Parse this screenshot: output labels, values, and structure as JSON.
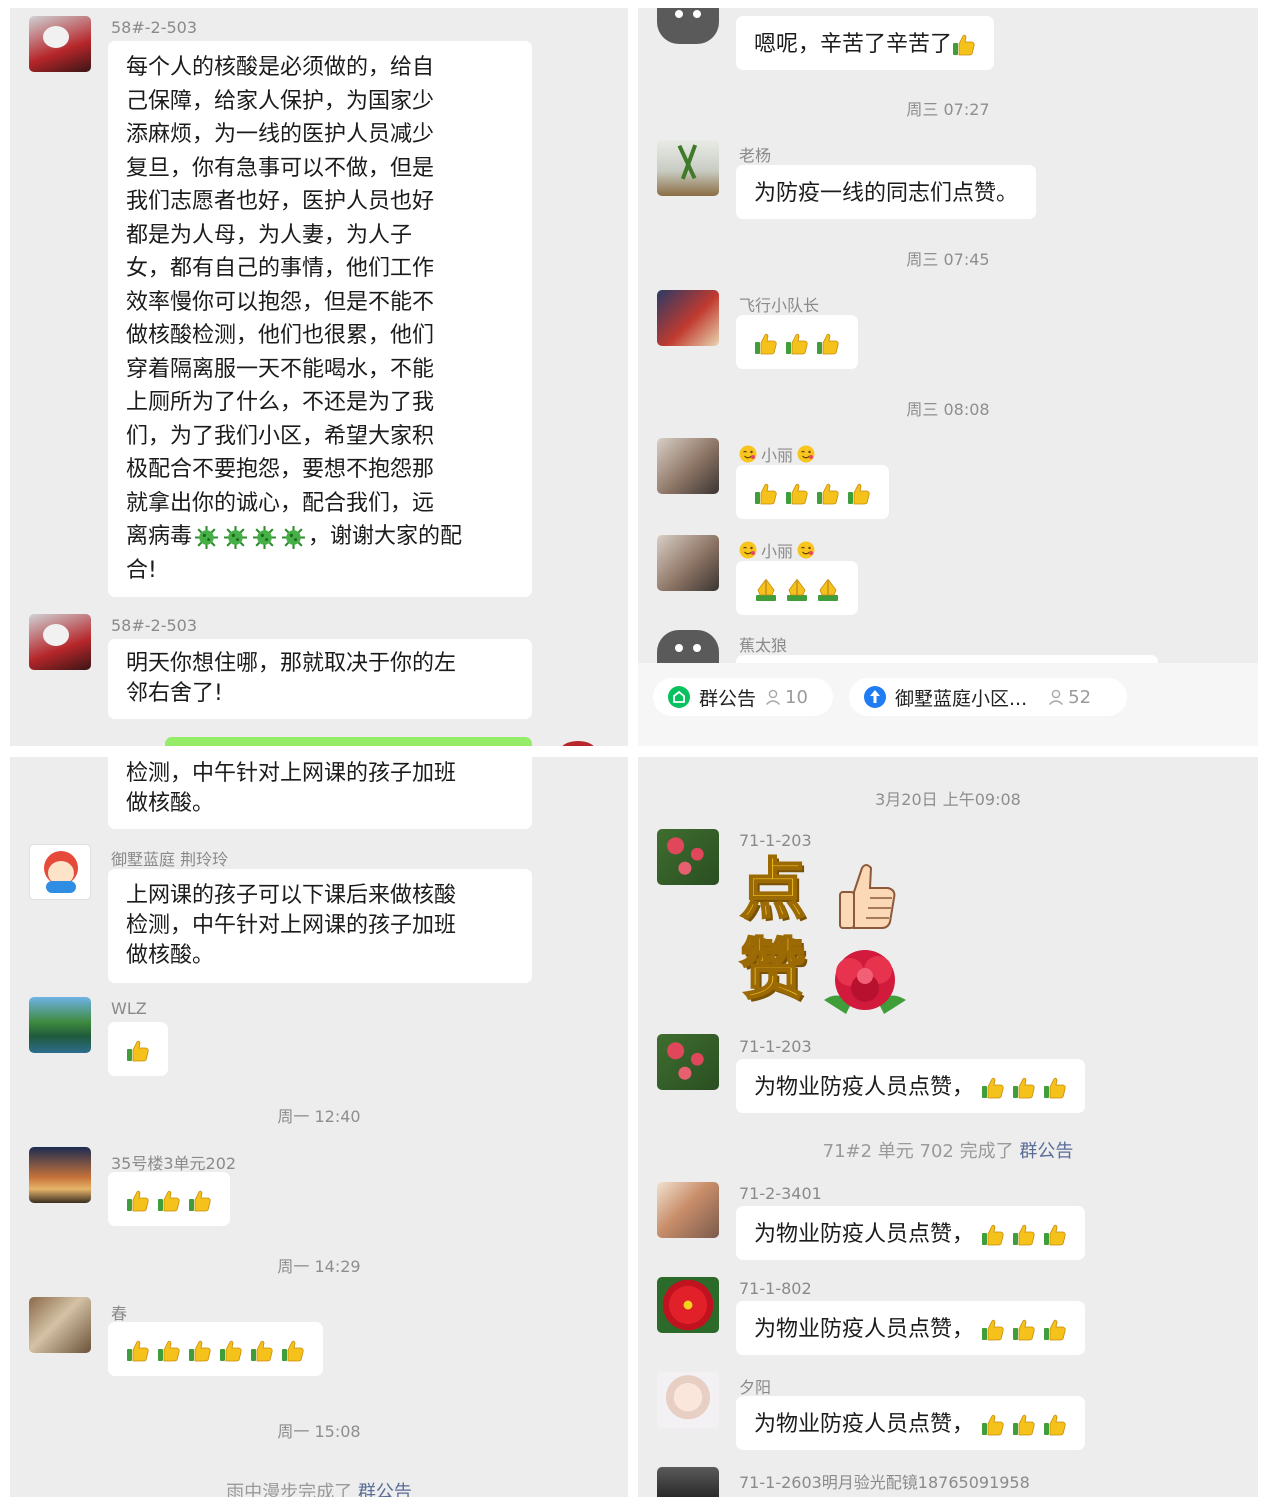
{
  "top_left": {
    "msg1": {
      "name": "58#-2-503",
      "lines": [
        "每个人的核酸是必须做的，给自",
        "己保障，给家人保护，为国家少",
        "添麻烦，为一线的医护人员减少",
        "复旦，你有急事可以不做，但是",
        "我们志愿者也好，医护人员也好",
        "都是为人母，为人妻，为人子",
        "女，都有自己的事情，他们工作",
        "效率慢你可以抱怨，但是不能不",
        "做核酸检测，他们也很累，他们",
        "穿着隔离服一天不能喝水，不能",
        "上厕所为了什么，不还是为了我",
        "们，为了我们小区，希望大家积",
        "极配合不要抱怨，要想不抱怨那",
        "就拿出你的诚心，配合我们，远"
      ],
      "line15_a": "离病毒",
      "line15_b": "，谢谢大家的配",
      "line16": "合!"
    },
    "msg2": {
      "name": "58#-2-503",
      "lines": [
        "明天你想住哪，那就取决于你的左",
        "邻右舍了!"
      ]
    }
  },
  "top_right": {
    "msg0": {
      "text": "嗯呢，辛苦了辛苦了"
    },
    "time1": "周三 07:27",
    "msg1": {
      "name": "老杨",
      "text": "为防疫一线的同志们点赞。"
    },
    "time2": "周三 07:45",
    "msg2": {
      "name": "飞行小队长"
    },
    "time3": "周三 08:08",
    "msg3": {
      "name": "小丽"
    },
    "msg4": {
      "name": "小丽"
    },
    "msg5": {
      "name": "蕉太狼"
    },
    "bar": {
      "notice_label": "群公告",
      "notice_count": "10",
      "group_label": "御墅蓝庭小区...",
      "group_count": "52",
      "accent": "#07c160"
    }
  },
  "bottom_left": {
    "msg0": {
      "lines": [
        "检测，中午针对上网课的孩子加班",
        "做核酸。"
      ]
    },
    "msg1": {
      "name": "御墅蓝庭 荆玲玲",
      "lines": [
        "上网课的孩子可以下课后来做核酸",
        "检测，中午针对上网课的孩子加班",
        "做核酸。"
      ]
    },
    "msg2": {
      "name": "WLZ"
    },
    "time1": "周一 12:40",
    "msg3": {
      "name": "35号楼3单元202"
    },
    "time2": "周一 14:29",
    "msg4": {
      "name": "春"
    },
    "time3": "周一 15:08",
    "sys_a": "雨中漫步完成了",
    "sys_link": "群公告"
  },
  "bottom_right": {
    "time0": "3月20日 上午09:08",
    "msg1": {
      "name": "71-1-203",
      "sticker_line1": "点",
      "sticker_line2": "赞"
    },
    "msg2": {
      "name": "71-1-203",
      "text": "为物业防疫人员点赞，"
    },
    "sys_a": "71#2 单元 702 完成了",
    "sys_link": "群公告",
    "msg3": {
      "name": "71-2-3401",
      "text": "为物业防疫人员点赞，"
    },
    "msg4": {
      "name": "71-1-802",
      "text": "为物业防疫人员点赞，"
    },
    "msg5": {
      "name": "夕阳",
      "text": "为物业防疫人员点赞，"
    },
    "msg6": {
      "name": "71-1-2603明月验光配镜18765091958"
    }
  }
}
